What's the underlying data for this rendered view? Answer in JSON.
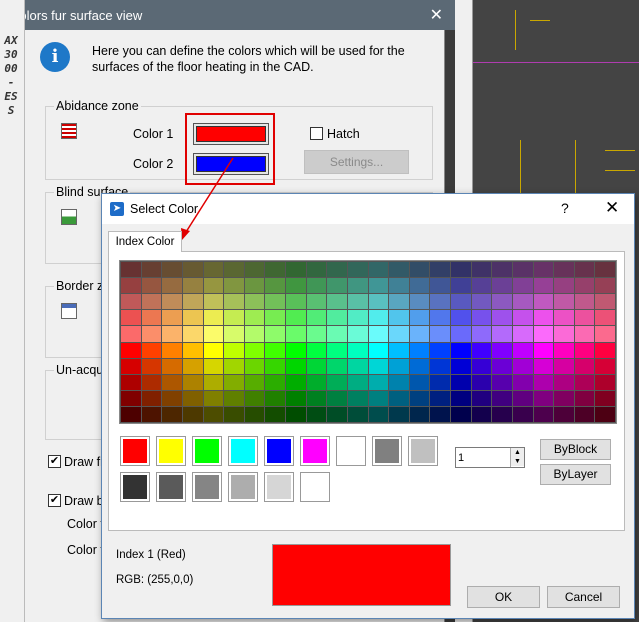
{
  "sidebar": {
    "vertical_text": "AX3000 - ESS"
  },
  "main_dialog": {
    "title": "Colors fur surface view",
    "close_glyph": "✕",
    "info_text": "Here you can define the colors which will be used for the surfaces of the floor heating in the CAD.",
    "abidance_zone": {
      "legend": "Abidance zone",
      "color1_label": "Color 1",
      "color1_value": "#ff0000",
      "color2_label": "Color 2",
      "color2_value": "#0000ff",
      "hatch_label": "Hatch",
      "settings_button": "Settings..."
    },
    "blind_surface": {
      "legend": "Blind surface"
    },
    "border_zone": {
      "legend": "Border ze"
    },
    "unacquired": {
      "legend": "Un-acqu"
    },
    "draw_fi": {
      "label": "Draw fi",
      "checked": true
    },
    "draw_b": {
      "label": "Draw b",
      "checked": true
    },
    "color_row1": "Color f",
    "color_row2": "Color f"
  },
  "select_color": {
    "title": "Select Color",
    "help_glyph": "?",
    "close_glyph": "✕",
    "tab_label": "Index Color",
    "standard_colors_row1": [
      "#ff0000",
      "#ffff00",
      "#00ff00",
      "#00ffff",
      "#0000ff",
      "#ff00ff",
      "#ffffff",
      "#808080",
      "#c0c0c0"
    ],
    "standard_colors_row2": [
      "#333333",
      "#5a5a5a",
      "#858585",
      "#adadad",
      "#d6d6d6",
      "#ffffff"
    ],
    "index_value": "1",
    "byblock_label": "ByBlock",
    "bylayer_label": "ByLayer",
    "index_text": "Index 1 (Red)",
    "rgb_text": "RGB: (255,0,0)",
    "preview_color": "#ff0000",
    "ok_label": "OK",
    "cancel_label": "Cancel"
  }
}
